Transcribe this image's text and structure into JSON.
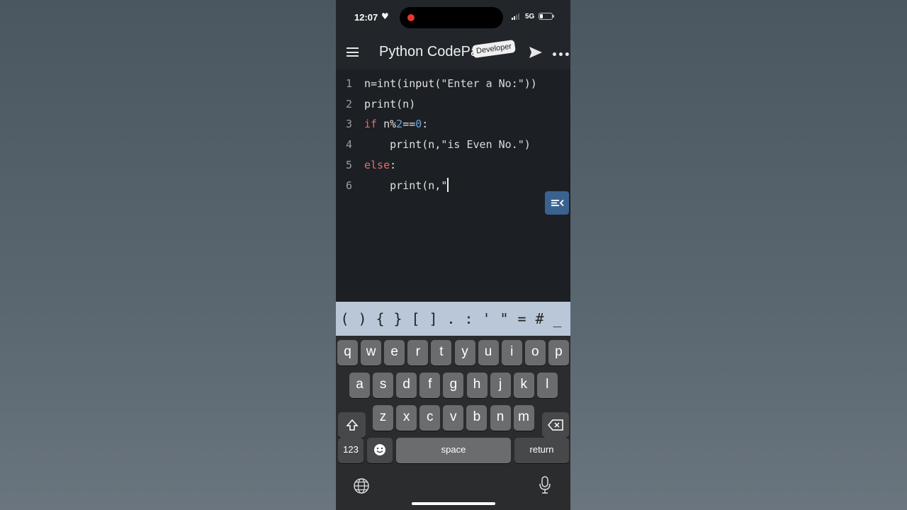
{
  "status": {
    "time": "12:07",
    "network": "5G",
    "battery_level": 0.25
  },
  "app": {
    "title": "Python CodePad",
    "badge": "Developer"
  },
  "editor": {
    "lines": [
      {
        "num": "1",
        "segments": [
          {
            "t": "n=int(input(",
            "c": ""
          },
          {
            "t": "\"Enter a No:\"",
            "c": "str"
          },
          {
            "t": "))",
            "c": ""
          }
        ]
      },
      {
        "num": "2",
        "segments": [
          {
            "t": "print(n)",
            "c": ""
          }
        ]
      },
      {
        "num": "3",
        "segments": [
          {
            "t": "if",
            "c": "kw"
          },
          {
            "t": " n%",
            "c": ""
          },
          {
            "t": "2",
            "c": "num"
          },
          {
            "t": "==",
            "c": ""
          },
          {
            "t": "0",
            "c": "num"
          },
          {
            "t": ":",
            "c": ""
          }
        ]
      },
      {
        "num": "4",
        "segments": [
          {
            "t": "    print(n,",
            "c": ""
          },
          {
            "t": "\"is Even No.\"",
            "c": "str"
          },
          {
            "t": ")",
            "c": ""
          }
        ]
      },
      {
        "num": "5",
        "segments": [
          {
            "t": "else",
            "c": "kw"
          },
          {
            "t": ":",
            "c": ""
          }
        ]
      },
      {
        "num": "6",
        "segments": [
          {
            "t": "    print(n,\"",
            "c": ""
          }
        ],
        "cursor": true
      }
    ]
  },
  "symbols": [
    "(",
    ")",
    "{",
    "}",
    "[",
    "]",
    ".",
    ":",
    "'",
    "\"",
    "=",
    "#",
    "_"
  ],
  "keyboard": {
    "row1": [
      "q",
      "w",
      "e",
      "r",
      "t",
      "y",
      "u",
      "i",
      "o",
      "p"
    ],
    "row2": [
      "a",
      "s",
      "d",
      "f",
      "g",
      "h",
      "j",
      "k",
      "l"
    ],
    "row3": [
      "z",
      "x",
      "c",
      "v",
      "b",
      "n",
      "m"
    ],
    "numbers_label": "123",
    "space_label": "space",
    "return_label": "return"
  },
  "icons": [
    "menu-icon",
    "send-icon",
    "more-icon",
    "outline-toggle-icon",
    "shift-icon",
    "delete-icon",
    "emoji-icon",
    "globe-icon",
    "microphone-icon"
  ]
}
